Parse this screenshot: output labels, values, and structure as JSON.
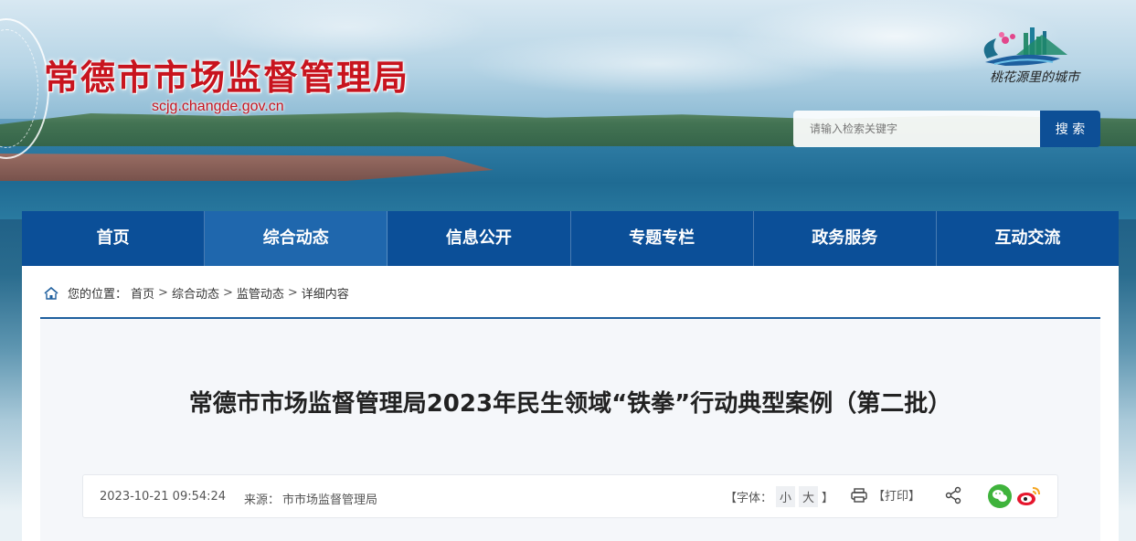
{
  "header": {
    "site_title": "常德市市场监督管理局",
    "domain": "scjg.changde.gov.cn",
    "slogan": "桃花源里的城市",
    "colors": {
      "title_red": "#c8141e",
      "nav_blue": "#0b4f98",
      "nav_active": "#1f67ad",
      "search_button": "#0d4f96"
    }
  },
  "search": {
    "placeholder": "请输入检索关键字",
    "value": "",
    "button_label": "搜 索",
    "icon": "search-icon"
  },
  "nav": {
    "items": [
      {
        "label": "首页",
        "active": false
      },
      {
        "label": "综合动态",
        "active": true
      },
      {
        "label": "信息公开",
        "active": false
      },
      {
        "label": "专题专栏",
        "active": false
      },
      {
        "label": "政务服务",
        "active": false
      },
      {
        "label": "互动交流",
        "active": false
      }
    ]
  },
  "breadcrumb": {
    "icon": "home-icon",
    "prefix": "您的位置：",
    "items": [
      "首页",
      "综合动态",
      "监管动态",
      "详细内容"
    ],
    "separator": ">"
  },
  "article": {
    "title": "常德市市场监督管理局2023年民生领域“铁拳”行动典型案例（第二批）",
    "date": "2023-10-21 09:54:24",
    "source_label": "来源：",
    "source": "市市场监督管理局",
    "font_label_open": "【字体：",
    "font_small": "小",
    "font_large": "大",
    "font_label_close": "】",
    "print_label": "【打印】",
    "icons": [
      "print-icon",
      "share-icon",
      "wechat-icon",
      "weibo-icon"
    ]
  }
}
